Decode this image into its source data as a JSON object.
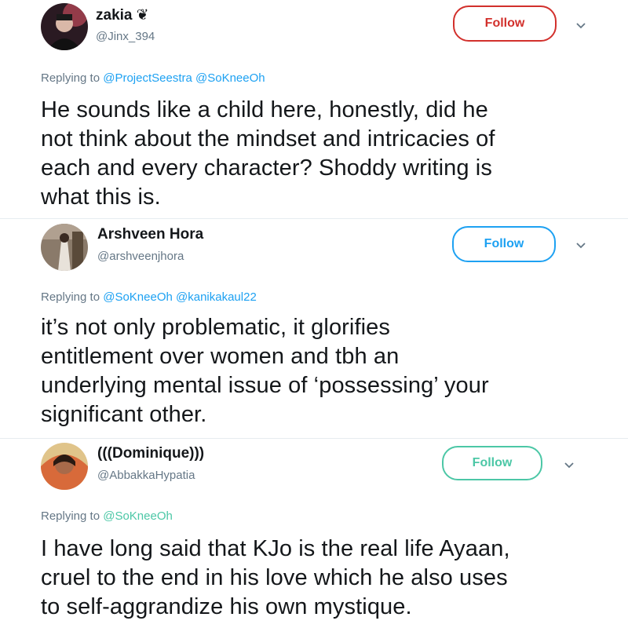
{
  "colors": {
    "follow_red": "#d2302c",
    "follow_blue": "#1da1f2",
    "follow_teal": "#4cc7a6",
    "mention": "#1da1f2",
    "muted": "#657786"
  },
  "tweets": [
    {
      "name": "zakia ❦",
      "handle": "@Jinx_394",
      "follow_label": "Follow",
      "reply_prefix": "Replying to",
      "mentions": "@ProjectSeestra @SoKneeOh",
      "text_lines": [
        "He sounds like a child here, honestly, did he",
        "not think about the mindset and intricacies of",
        "each and every character? Shoddy writing is",
        "what this is."
      ]
    },
    {
      "name": "Arshveen Hora",
      "handle": "@arshveenjhora",
      "follow_label": "Follow",
      "reply_prefix": "Replying to",
      "mentions": "@SoKneeOh @kanikakaul22",
      "text_lines": [
        "it’s not only problematic, it glorifies",
        "entitlement over women and tbh an",
        "underlying mental issue of ‘possessing’ your",
        "significant other."
      ]
    },
    {
      "name": "(((Dominique)))",
      "handle": "@AbbakkaHypatia",
      "follow_label": "Follow",
      "reply_prefix": "Replying to",
      "mentions": "@SoKneeOh",
      "text_lines": [
        "I have long said that KJo is the real life Ayaan,",
        "cruel to the end in his love which he also uses",
        "to self-aggrandize his own mystique."
      ]
    }
  ]
}
